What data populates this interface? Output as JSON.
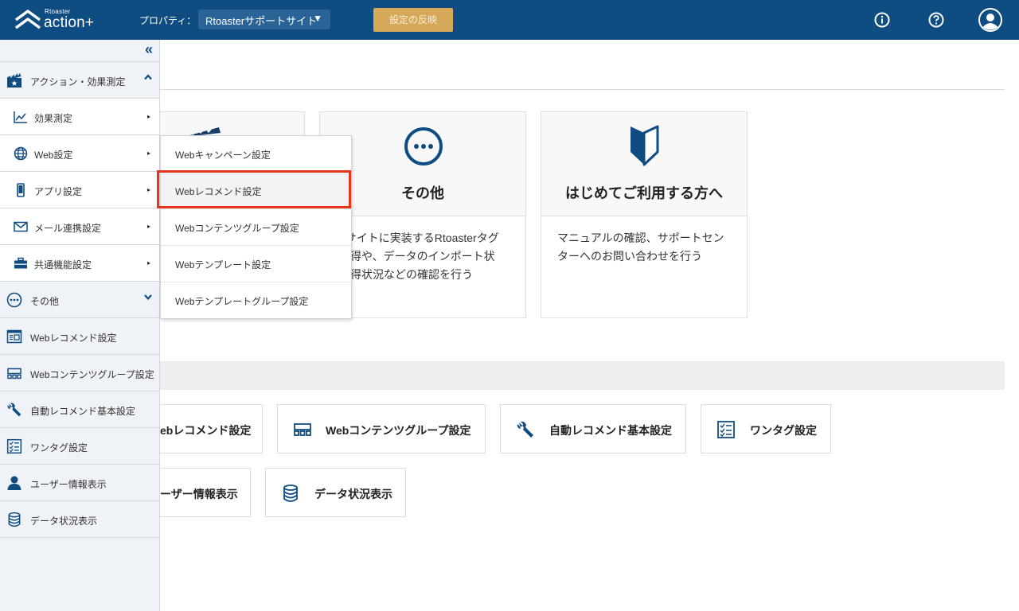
{
  "header": {
    "brand_small": "Rtoaster",
    "brand_main": "action+",
    "property_label": "プロパティ：",
    "property_value": "Rtoasterサポートサイト",
    "property_caret": "▼",
    "apply_label": "設定の反映",
    "icons": [
      "info-icon",
      "help-icon",
      "user-avatar-icon"
    ]
  },
  "sidebar": {
    "collapse_glyph": "«",
    "items": [
      {
        "label": "アクション・効果測定",
        "icon": "clapperboard-icon"
      },
      {
        "label": "効果測定",
        "icon": "chart-line-icon"
      },
      {
        "label": "Web設定",
        "icon": "globe-icon"
      },
      {
        "label": "アプリ設定",
        "icon": "smartphone-icon"
      },
      {
        "label": "メール連携設定",
        "icon": "envelope-icon"
      },
      {
        "label": "共通機能設定",
        "icon": "toolbox-icon"
      },
      {
        "label": "その他",
        "icon": "ellipsis-circle-icon"
      },
      {
        "label": "Webレコメンド設定",
        "icon": "web-recommend-icon"
      },
      {
        "label": "Webコンテンツグループ設定",
        "icon": "content-group-icon"
      },
      {
        "label": "自動レコメンド基本設定",
        "icon": "wrench-icon"
      },
      {
        "label": "ワンタグ設定",
        "icon": "checklist-icon"
      },
      {
        "label": "ユーザー情報表示",
        "icon": "user-icon"
      },
      {
        "label": "データ状況表示",
        "icon": "database-icon"
      }
    ],
    "arrow_glyph": "▸"
  },
  "flyout": {
    "items": [
      {
        "label": "Webキャンペーン設定"
      },
      {
        "label": "Webレコメンド設定"
      },
      {
        "label": "Webコンテンツグループ設定"
      },
      {
        "label": "Webテンプレート設定"
      },
      {
        "label": "Webテンプレートグループ設定"
      }
    ]
  },
  "cards": [
    {
      "title": "その他",
      "desc_lines": [
        "bサイトに実装するRtoasterタグ",
        "取得や、データのインポート状",
        "取得状況などの確認を行う"
      ],
      "icon": "ellipsis-circle-icon"
    },
    {
      "title": "はじめてご利用する方へ",
      "desc_lines": [
        "マニュアルの確認、サポートセン",
        "ターへのお問い合わせを行う"
      ],
      "icon": "beginner-mark-icon"
    }
  ],
  "quick_links": [
    {
      "label": "ebレコメンド設定"
    },
    {
      "label": "Webコンテンツグループ設定",
      "icon": "content-group-icon"
    },
    {
      "label": "自動レコメンド基本設定",
      "icon": "wrench-icon"
    },
    {
      "label": "ワンタグ設定",
      "icon": "checklist-icon"
    },
    {
      "label": "ーザー情報表示"
    },
    {
      "label": "データ状況表示",
      "icon": "database-icon"
    }
  ],
  "colors": {
    "header_bg": "#0f4c81",
    "accent_button": "#d6a95a",
    "highlight_border": "#e8341c",
    "sidebar_bg": "#eff2f6"
  }
}
